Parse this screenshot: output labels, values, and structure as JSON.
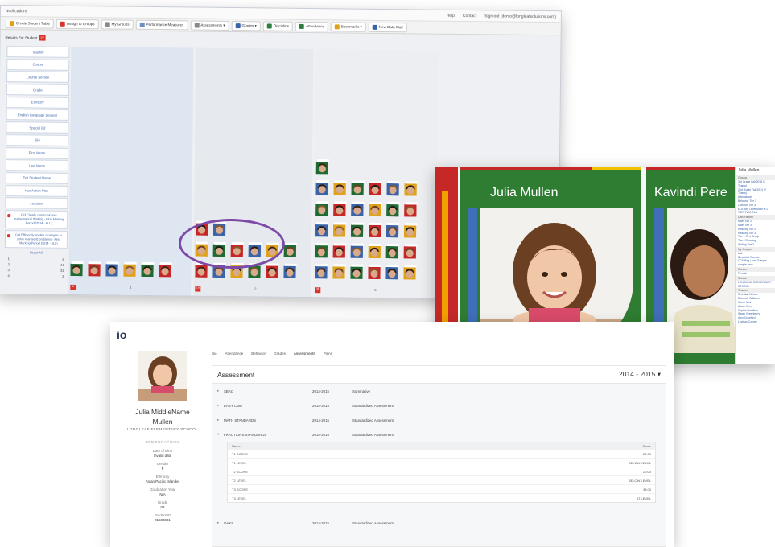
{
  "wall": {
    "top_left": "Notifications",
    "top_links": [
      "Help",
      "Contact",
      "Sign out (demo@longleafsolutions.com)"
    ],
    "toolbar": [
      {
        "label": "Create Student Table",
        "color": "#e0a21b"
      },
      {
        "label": "Assign to Groups",
        "color": "#d9342b"
      },
      {
        "label": "My Groups",
        "color": "#8a8a8a"
      },
      {
        "label": "Performance Measures",
        "color": "#6b8fc9"
      },
      {
        "label": "Assessments ▾",
        "color": "#8a8a8a"
      },
      {
        "label": "Grades ▾",
        "color": "#3a63a8"
      },
      {
        "label": "Discipline",
        "color": "#2d7d3e"
      },
      {
        "label": "Attendance",
        "color": "#2d7d3e"
      },
      {
        "label": "Bookmarks ▾",
        "color": "#e0a21b"
      },
      {
        "label": "New Data Wall",
        "color": "#3a63a8"
      }
    ],
    "results_label": "Results For Student",
    "results_badge": "27",
    "side_items": [
      "Teacher",
      "Course",
      "Course Section",
      "Grade",
      "Ethnicity",
      "English Language Learner",
      "Special Ed",
      "504",
      "First Name",
      "Last Name",
      "Full Student Name",
      "Has Action Plan",
      "Location"
    ],
    "side_filters": [
      "Gr3 Clearly communicates mathematical thinking - First Marking Period (2014 - ALL)",
      "Gr3 Efficiently applies strategies to solve real world problems - First Marking Period (2014 - ALL)"
    ],
    "reset_label": "Reset All",
    "counts": [
      {
        "k": "1",
        "v": "6"
      },
      {
        "k": "2",
        "v": "14"
      },
      {
        "k": "3",
        "v": "31"
      },
      {
        "k": "4",
        "v": "2"
      }
    ],
    "columns": [
      {
        "label": "1",
        "badge": "6"
      },
      {
        "label": "2",
        "badge": "14"
      },
      {
        "label": "3",
        "badge": "31"
      }
    ]
  },
  "cards": {
    "student1": "Julia Mullen",
    "student2": "Kavindi Pere",
    "panel_title": "Julia Mullen",
    "panel_sections": [
      {
        "title": "Groups",
        "items": [
          "3rd Grade Fall 2014 (2 Teams)",
          "2nd Grade Fall 2014 (2 Teams)",
          "Attendance",
          "Behavior Tier 3",
          "Conduct Tier 3",
          "ELA Beg Level Math K-1",
          "TIER TWO ELA"
        ]
      },
      {
        "title": "Cert. History",
        "items": [
          "Math Tier 2",
          "Math Tier 3",
          "Reading Tier 2",
          "Reading Tier 3",
          "Tier 1 Cert Group",
          "Tier 2 Reading",
          "Writing Tier 3"
        ]
      },
      {
        "title": "My Groups",
        "items": [
          "test",
          "Breakfast Sample",
          "CCK Beg Level Sample",
          "sample here"
        ]
      },
      {
        "title": "Gender",
        "items": [
          "Female"
        ]
      },
      {
        "title": "School",
        "items": [
          "LONGLEAF ELEMENTARY SCHOOL"
        ]
      },
      {
        "title": "Teacher",
        "items": [
          "Christian Nelson",
          "Deborah Williams",
          "Karen Mini",
          "Alison Keen",
          "Sophia Hamilton",
          "Sarah Greenberry",
          "Amy Crawford",
          "Lindsay Conner"
        ]
      }
    ]
  },
  "profile": {
    "logo": "io",
    "first_name": "Julia MiddleName",
    "last_name": "Mullen",
    "school": "LONGLEAF ELEMENTARY SCHOOL",
    "demographics_label": "DEMOGRAPHICS",
    "fields": [
      {
        "k": "Date of Birth",
        "v": "Invalid date"
      },
      {
        "k": "Gender",
        "v": "F"
      },
      {
        "k": "Ethnicity",
        "v": "Asian/Pacific Islander"
      },
      {
        "k": "Graduation Year",
        "v": "N/A"
      },
      {
        "k": "Grade",
        "v": "03"
      },
      {
        "k": "Student ID",
        "v": "01603381"
      }
    ],
    "tabs": [
      "Bio",
      "Attendance",
      "Behavior",
      "Grades",
      "Assessments",
      "Plans"
    ],
    "active_tab": "Assessments",
    "section_title": "Assessment",
    "year_select": "2014 - 2015  ▾",
    "rows": [
      {
        "name": "SBAC",
        "year": "2014-2015",
        "type": "Summative"
      },
      {
        "name": "EASY CBM",
        "year": "2014-2015",
        "type": "Standardized Assessment"
      },
      {
        "name": "MATH STANDARDS",
        "year": "2014-2015",
        "type": "Standardized Assessment"
      },
      {
        "name": "FRACTIONS STANDARDS",
        "year": "2014-2015",
        "type": "Standardized Assessment"
      }
    ],
    "sub_head": {
      "name": "Name",
      "score": "Score"
    },
    "scores": [
      {
        "name": "T1 SCORE",
        "score": "20.00"
      },
      {
        "name": "T1 LEVEL",
        "score": "BELOW LEVEL"
      },
      {
        "name": "T2 SCORE",
        "score": "20.00"
      },
      {
        "name": "T2 LEVEL",
        "score": "BELOW LEVEL"
      },
      {
        "name": "T3 SCORE",
        "score": "38.00"
      },
      {
        "name": "T3 LEVEL",
        "score": "AT LEVEL"
      }
    ],
    "last_row": {
      "name": "OAKS",
      "year": "2014-2015",
      "type": "Standardized Assessment"
    }
  }
}
